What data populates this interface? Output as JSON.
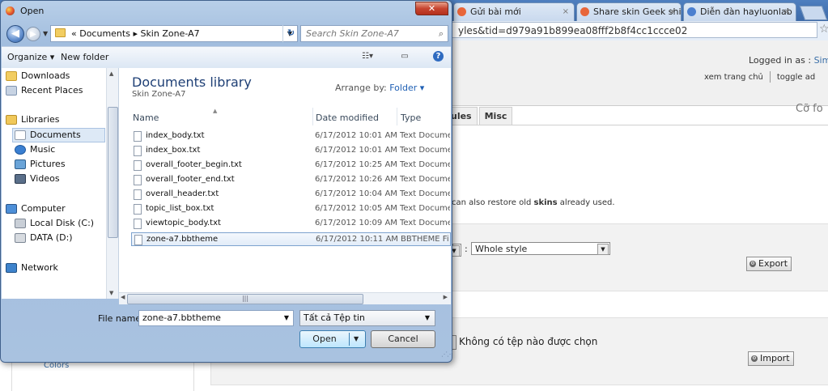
{
  "browser": {
    "tabs": [
      {
        "label": "Gửi bài mới",
        "color": "#e8663a"
      },
      {
        "label": "Share skin Geek shiel",
        "color": "#e8663a"
      },
      {
        "label": "Diễn đàn hayluonlab",
        "color": "#4b7fcf"
      }
    ],
    "url": "yles&tid=d979a91b899ea08fff2b8f4cc1ccce02"
  },
  "page": {
    "logged_in": "Logged in as :",
    "logged_user": "Sim",
    "link_home": "xem trang chủ",
    "link_toggle": "toggle ad",
    "tabs": [
      "ules",
      "Misc"
    ],
    "font_size_label": "Cỡ fo",
    "description_pre": "can also restore old ",
    "description_bold": "skins",
    "description_post": " already used.",
    "export_select": "Whole style",
    "export_button": "Export",
    "no_file": "Không có tệp nào được chọn",
    "import_button": "Import",
    "left_link": "Colors"
  },
  "dialog": {
    "title": "Open",
    "breadcrumb": "« Documents ▸ Skin Zone-A7",
    "search_placeholder": "Search Skin Zone-A7",
    "organize": "Organize ▾",
    "new_folder": "New folder",
    "nav": {
      "downloads": "Downloads",
      "recent": "Recent Places",
      "libraries": "Libraries",
      "documents": "Documents",
      "music": "Music",
      "pictures": "Pictures",
      "videos": "Videos",
      "computer": "Computer",
      "local_disk": "Local Disk (C:)",
      "data": "DATA (D:)",
      "network": "Network"
    },
    "library_title": "Documents library",
    "library_sub": "Skin Zone-A7",
    "arrange_by": "Arrange by:",
    "arrange_value": "Folder ▾",
    "columns": {
      "name": "Name",
      "date": "Date modified",
      "type": "Type"
    },
    "files": [
      {
        "name": "index_body.txt",
        "date": "6/17/2012 10:01 AM",
        "type": "Text Docume"
      },
      {
        "name": "index_box.txt",
        "date": "6/17/2012 10:01 AM",
        "type": "Text Docume"
      },
      {
        "name": "overall_footer_begin.txt",
        "date": "6/17/2012 10:25 AM",
        "type": "Text Docume"
      },
      {
        "name": "overall_footer_end.txt",
        "date": "6/17/2012 10:26 AM",
        "type": "Text Docume"
      },
      {
        "name": "overall_header.txt",
        "date": "6/17/2012 10:04 AM",
        "type": "Text Docume"
      },
      {
        "name": "topic_list_box.txt",
        "date": "6/17/2012 10:05 AM",
        "type": "Text Docume"
      },
      {
        "name": "viewtopic_body.txt",
        "date": "6/17/2012 10:09 AM",
        "type": "Text Docume"
      },
      {
        "name": "zone-a7.bbtheme",
        "date": "6/17/2012 10:11 AM",
        "type": "BBTHEME Fi"
      }
    ],
    "file_name_label": "File name:",
    "file_name_value": "zone-a7.bbtheme",
    "file_type": "Tất cả Tệp tin",
    "open_button": "Open",
    "cancel_button": "Cancel"
  }
}
